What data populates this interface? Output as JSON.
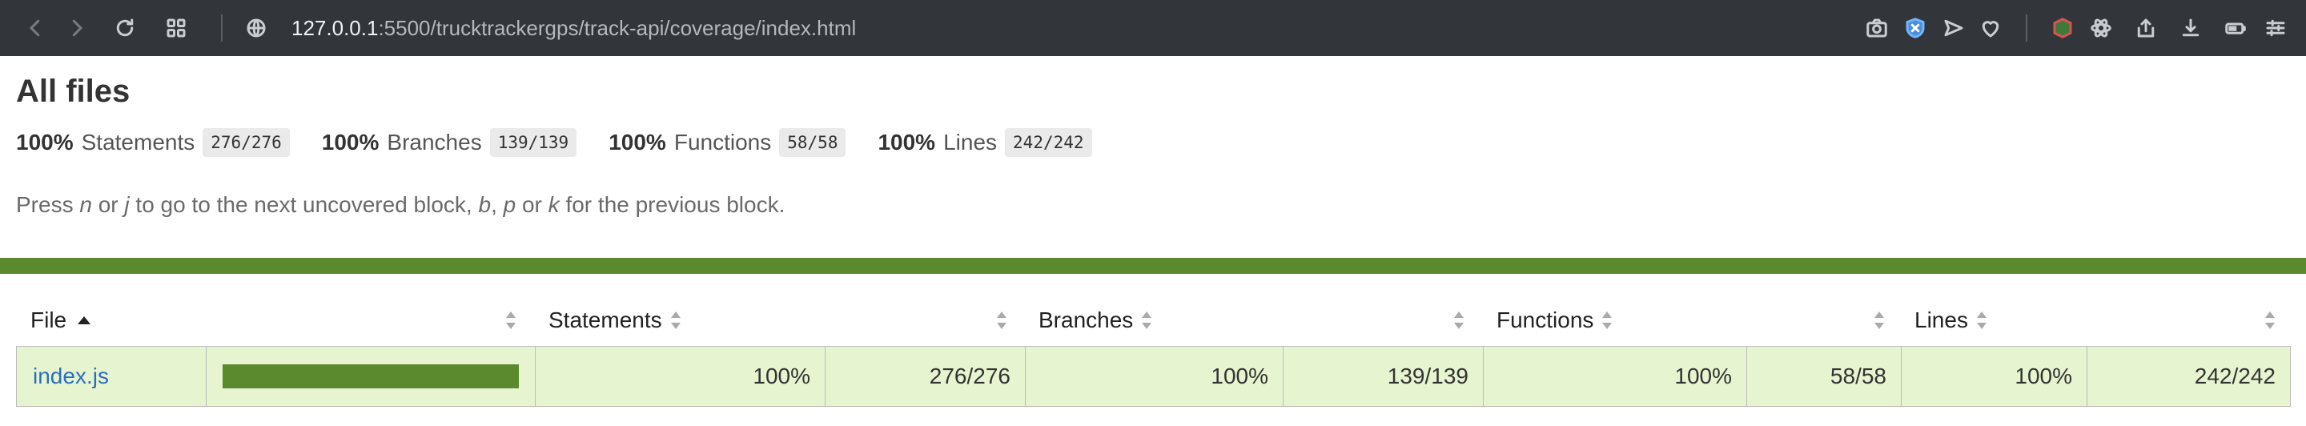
{
  "browser": {
    "url_host": "127.0.0.1",
    "url_path": ":5500/trucktrackergps/track-api/coverage/index.html"
  },
  "report": {
    "title": "All files",
    "summary": [
      {
        "pct": "100%",
        "label": "Statements",
        "fraction": "276/276"
      },
      {
        "pct": "100%",
        "label": "Branches",
        "fraction": "139/139"
      },
      {
        "pct": "100%",
        "label": "Functions",
        "fraction": "58/58"
      },
      {
        "pct": "100%",
        "label": "Lines",
        "fraction": "242/242"
      }
    ],
    "hint": {
      "press": "Press",
      "key_n": "n",
      "or1": "or",
      "key_j": "j",
      "mid": "to go to the next uncovered block,",
      "key_b": "b",
      "comma": ",",
      "key_p": "p",
      "or2": "or",
      "key_k": "k",
      "end": "for the previous block."
    },
    "status_color": "#5b8a2e"
  },
  "table": {
    "headers": {
      "file": "File",
      "statements": "Statements",
      "branches": "Branches",
      "functions": "Functions",
      "lines": "Lines"
    },
    "rows": [
      {
        "file": "index.js",
        "coverage_fraction": 1.0,
        "statements_pct": "100%",
        "statements_frac": "276/276",
        "branches_pct": "100%",
        "branches_frac": "139/139",
        "functions_pct": "100%",
        "functions_frac": "58/58",
        "lines_pct": "100%",
        "lines_frac": "242/242"
      }
    ],
    "row_color": "#e6f5d0"
  }
}
